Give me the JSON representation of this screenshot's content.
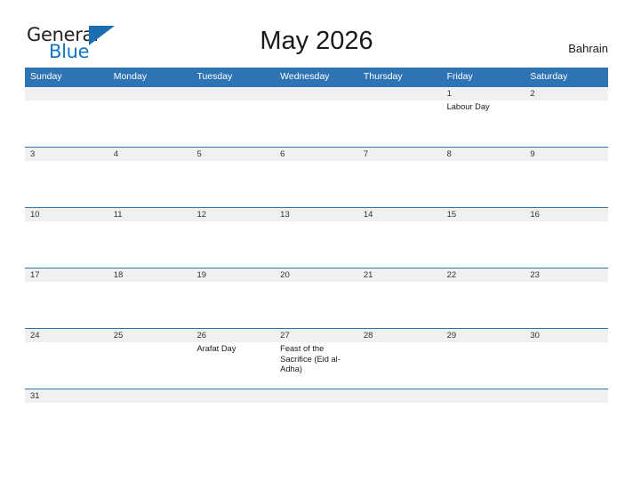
{
  "brand": {
    "name_part1": "General",
    "name_part2": "Blue",
    "flag_icon": "blue-triangle-flag",
    "color_dark": "#231f20",
    "color_blue": "#1274c4"
  },
  "header": {
    "title": "May 2026",
    "country": "Bahrain",
    "accent_color": "#2e74b5"
  },
  "weekdays": [
    "Sunday",
    "Monday",
    "Tuesday",
    "Wednesday",
    "Thursday",
    "Friday",
    "Saturday"
  ],
  "weeks": [
    {
      "dates": [
        "",
        "",
        "",
        "",
        "",
        "1",
        "2"
      ],
      "events": [
        "",
        "",
        "",
        "",
        "",
        "Labour Day",
        ""
      ]
    },
    {
      "dates": [
        "3",
        "4",
        "5",
        "6",
        "7",
        "8",
        "9"
      ],
      "events": [
        "",
        "",
        "",
        "",
        "",
        "",
        ""
      ]
    },
    {
      "dates": [
        "10",
        "11",
        "12",
        "13",
        "14",
        "15",
        "16"
      ],
      "events": [
        "",
        "",
        "",
        "",
        "",
        "",
        ""
      ]
    },
    {
      "dates": [
        "17",
        "18",
        "19",
        "20",
        "21",
        "22",
        "23"
      ],
      "events": [
        "",
        "",
        "",
        "",
        "",
        "",
        ""
      ]
    },
    {
      "dates": [
        "24",
        "25",
        "26",
        "27",
        "28",
        "29",
        "30"
      ],
      "events": [
        "",
        "",
        "Arafat Day",
        "Feast of the Sacrifice (Eid al-Adha)",
        "",
        "",
        ""
      ]
    },
    {
      "dates": [
        "31",
        "",
        "",
        "",
        "",
        "",
        ""
      ],
      "events": [
        "",
        "",
        "",
        "",
        "",
        "",
        ""
      ]
    }
  ]
}
